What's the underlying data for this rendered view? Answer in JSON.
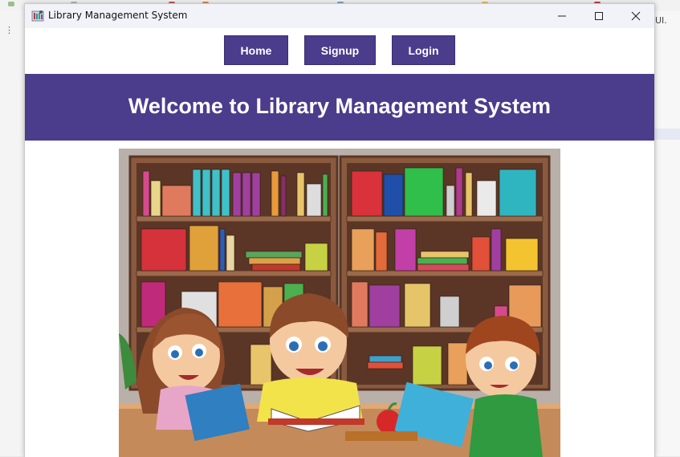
{
  "window": {
    "title": "Library Management System",
    "controls": {
      "minimize": "─",
      "maximize": "☐",
      "close": "✕"
    }
  },
  "nav": {
    "home": "Home",
    "signup": "Signup",
    "login": "Login"
  },
  "banner": {
    "heading": "Welcome to Library Management System"
  },
  "background": {
    "right_text": "UI."
  },
  "colors": {
    "accent": "#4b3c8c",
    "shelf": "#7a4a34",
    "wall": "#b8aea6"
  },
  "icons": [
    "app-icon",
    "minimize-icon",
    "maximize-icon",
    "close-icon"
  ]
}
